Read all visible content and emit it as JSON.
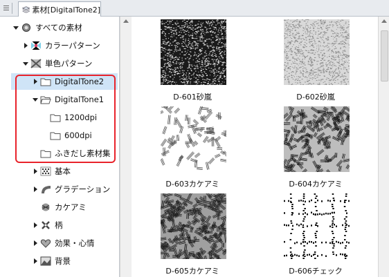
{
  "tab": {
    "label": "素材[DigitalTone2]"
  },
  "tree": [
    {
      "label": "すべての素材",
      "caret": "down",
      "icon": "materials-root-icon",
      "indent": 0
    },
    {
      "label": "カラーパターン",
      "caret": "right",
      "icon": "color-pattern-icon",
      "indent": 1
    },
    {
      "label": "単色パターン",
      "caret": "down",
      "icon": "monochrome-pattern-icon",
      "indent": 1
    },
    {
      "label": "DigitalTone2",
      "caret": "right",
      "icon": "folder-icon",
      "indent": 2,
      "selected": true
    },
    {
      "label": "DigitalTone1",
      "caret": "down",
      "icon": "folder-open-icon",
      "indent": 2
    },
    {
      "label": "1200dpi",
      "caret": "",
      "icon": "folder-icon",
      "indent": 3
    },
    {
      "label": "600dpi",
      "caret": "",
      "icon": "folder-icon",
      "indent": 3
    },
    {
      "label": "ふきだし素材集",
      "caret": "",
      "icon": "folder-icon",
      "indent": 2
    },
    {
      "label": "基本",
      "caret": "right",
      "icon": "basic-tone-icon",
      "indent": 2
    },
    {
      "label": "グラデーション",
      "caret": "right",
      "icon": "gradation-icon",
      "indent": 2
    },
    {
      "label": "カケアミ",
      "caret": "",
      "icon": "crosshatch-icon",
      "indent": 2
    },
    {
      "label": "柄",
      "caret": "right",
      "icon": "pattern-icon",
      "indent": 2
    },
    {
      "label": "効果・心情",
      "caret": "right",
      "icon": "effect-emotion-icon",
      "indent": 2
    },
    {
      "label": "背景",
      "caret": "right",
      "icon": "background-icon",
      "indent": 2
    }
  ],
  "materials": [
    {
      "name": "D-601砂嵐",
      "type": "noise-dark"
    },
    {
      "name": "D-602砂嵐",
      "type": "noise-light"
    },
    {
      "name": "D-603カケアミ",
      "type": "hatch-light"
    },
    {
      "name": "D-604カケアミ",
      "type": "hatch-mid"
    },
    {
      "name": "D-605カケアミ",
      "type": "hatch-dark"
    },
    {
      "name": "D-606チェック",
      "type": "check"
    }
  ]
}
